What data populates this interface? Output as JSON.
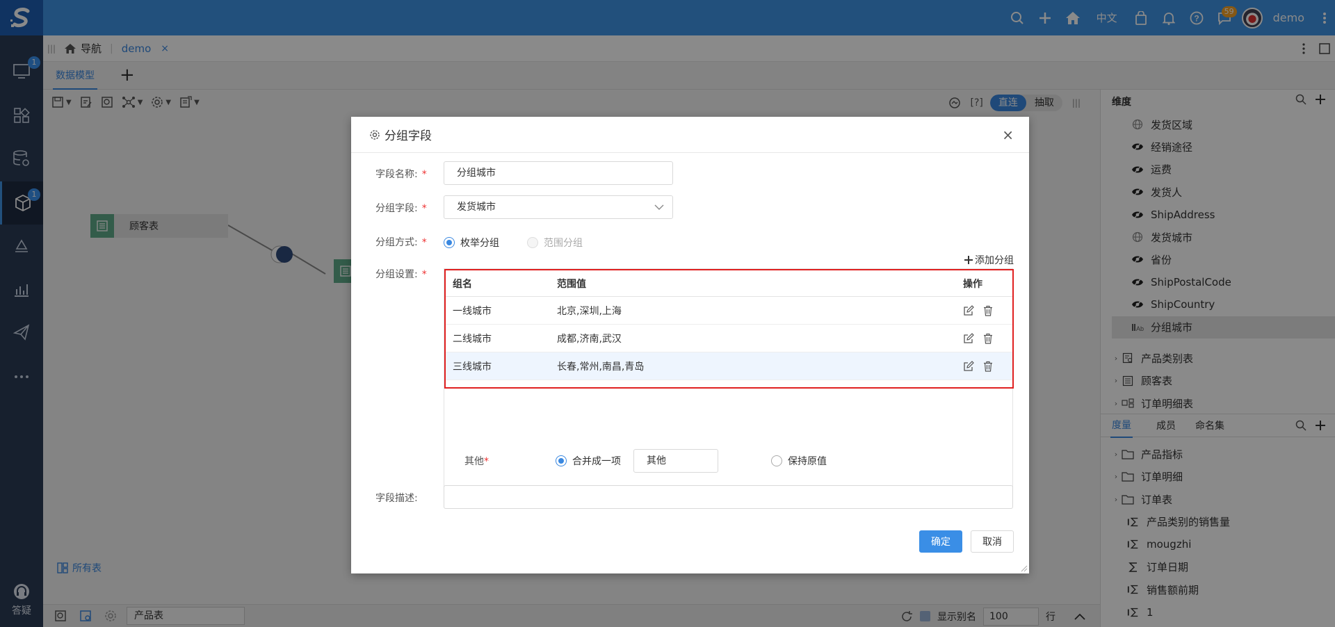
{
  "header": {
    "language": "中文",
    "message_badge": "59",
    "username": "demo"
  },
  "sidebar": {
    "badges": [
      "1",
      "1"
    ],
    "help_label": "答疑"
  },
  "navbar": {
    "nav_label": "导航",
    "tab_name": "demo",
    "tab_close": "×"
  },
  "subtabs": {
    "active": "数据模型",
    "add": "+"
  },
  "canvas": {
    "mode_toggle": {
      "bracket_label": "[?]",
      "on": "直连",
      "off": "抽取"
    },
    "nodes": [
      {
        "label": "顾客表"
      }
    ],
    "all_tables": "所有表"
  },
  "statusbar": {
    "table_input": "产品表",
    "show_alias": "显示别名",
    "rows_value": "100",
    "rows_unit": "行"
  },
  "right_panel": {
    "dimension_title": "维度",
    "dimension_items": [
      {
        "label": "发货区域",
        "icon": "globe-icon"
      },
      {
        "label": "经销途径",
        "icon": "eye-icon"
      },
      {
        "label": "运费",
        "icon": "eye-icon"
      },
      {
        "label": "发货人",
        "icon": "eye-icon"
      },
      {
        "label": "ShipAddress",
        "icon": "eye-icon"
      },
      {
        "label": "发货城市",
        "icon": "globe-icon"
      },
      {
        "label": "省份",
        "icon": "eye-icon"
      },
      {
        "label": "ShipPostalCode",
        "icon": "eye-icon"
      },
      {
        "label": "ShipCountry",
        "icon": "eye-icon"
      },
      {
        "label": "分组城市",
        "icon": "group-field-icon",
        "selected": true
      }
    ],
    "table_items": [
      {
        "label": "产品类别表"
      },
      {
        "label": "顾客表"
      },
      {
        "label": "订单明细表"
      }
    ],
    "measure_tabs": [
      "度量",
      "成员",
      "命名集"
    ],
    "measure_folders": [
      "产品指标",
      "订单明细",
      "订单表"
    ],
    "measure_items": [
      "产品类别的销售量",
      "mougzhi",
      "订单日期",
      "销售额前期",
      "1"
    ]
  },
  "dialog": {
    "title": "分组字段",
    "close": "×",
    "field_name_label": "字段名称:",
    "field_name_value": "分组城市",
    "group_field_label": "分组字段:",
    "group_field_value": "发货城市",
    "group_method_label": "分组方式:",
    "method_enum": "枚举分组",
    "method_range": "范围分组",
    "group_settings_label": "分组设置:",
    "add_group": "添加分组",
    "required_mark": "*",
    "table": {
      "headers": [
        "组名",
        "范围值",
        "操作"
      ],
      "rows": [
        {
          "name": "一线城市",
          "values": "北京,深圳,上海"
        },
        {
          "name": "二线城市",
          "values": "成都,济南,武汉"
        },
        {
          "name": "三线城市",
          "values": "长春,常州,南昌,青岛"
        }
      ]
    },
    "other_label": "其他",
    "merge_option": "合并成一项",
    "merge_value": "其他",
    "keep_original": "保持原值",
    "description_label": "字段描述:",
    "description_value": "",
    "ok": "确定",
    "cancel": "取消"
  },
  "colors": {
    "header_blue": "#4095e5",
    "sidebar_dark": "#2c3b55",
    "accent": "#3a88e0",
    "highlight_border": "#e02020"
  }
}
